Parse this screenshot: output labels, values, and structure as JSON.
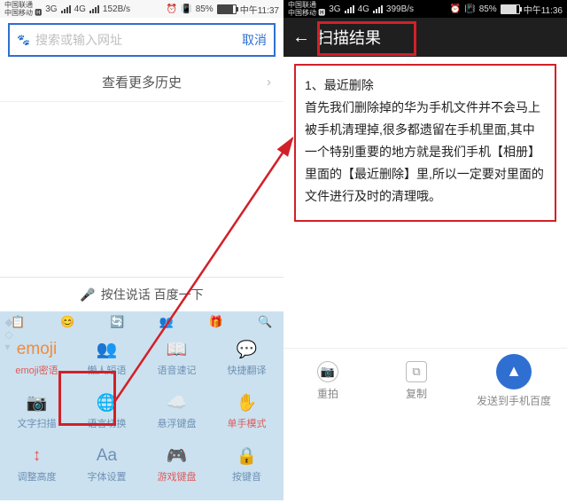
{
  "left": {
    "status": {
      "carrier1": "中国联通",
      "carrier2": "中国移动",
      "net1": "3G",
      "net2": "4G",
      "speed": "152B/s",
      "battery": "85%",
      "time": "中午11:37"
    },
    "search": {
      "placeholder": "搜索或输入网址",
      "cancel": "取消"
    },
    "history_more": "查看更多历史",
    "voice_hint": "按住说话 百度一下",
    "kb_header": [
      "📋",
      "😊",
      "🔄",
      "👥",
      "🎁",
      "🔍"
    ],
    "kb_rows": [
      [
        {
          "icon": "emoji",
          "label": "emoji密语",
          "hot": true
        },
        {
          "icon": "👥",
          "label": "懒人短语"
        },
        {
          "icon": "📖",
          "label": "语音速记"
        },
        {
          "icon": "💬",
          "label": "快捷翻译"
        }
      ],
      [
        {
          "icon": "📷",
          "label": "文字扫描",
          "blue": true
        },
        {
          "icon": "🌐",
          "label": "语言切换"
        },
        {
          "icon": "☁️",
          "label": "悬浮键盘"
        },
        {
          "icon": "✋",
          "label": "单手模式",
          "hot": true
        }
      ],
      [
        {
          "icon": "↕",
          "label": "调整高度",
          "red": true
        },
        {
          "icon": "Aa",
          "label": "字体设置"
        },
        {
          "icon": "🎮",
          "label": "游戏键盘",
          "hot": true
        },
        {
          "icon": "🔒",
          "label": "按键音"
        }
      ]
    ]
  },
  "right": {
    "status": {
      "carrier1": "中国联通",
      "carrier2": "中国移动",
      "net1": "3G",
      "net2": "4G",
      "speed": "399B/s",
      "battery": "85%",
      "time": "中午11:36"
    },
    "title": "扫描结果",
    "result_heading": "1、最近删除",
    "result_body": "首先我们删除掉的华为手机文件并不会马上被手机清理掉,很多都遗留在手机里面,其中一个特别重要的地方就是我们手机【相册】里面的【最近删除】里,所以一定要对里面的文件进行及时的清理哦。",
    "actions": {
      "retake": "重拍",
      "copy": "复制",
      "send": "发送到手机百度"
    }
  }
}
